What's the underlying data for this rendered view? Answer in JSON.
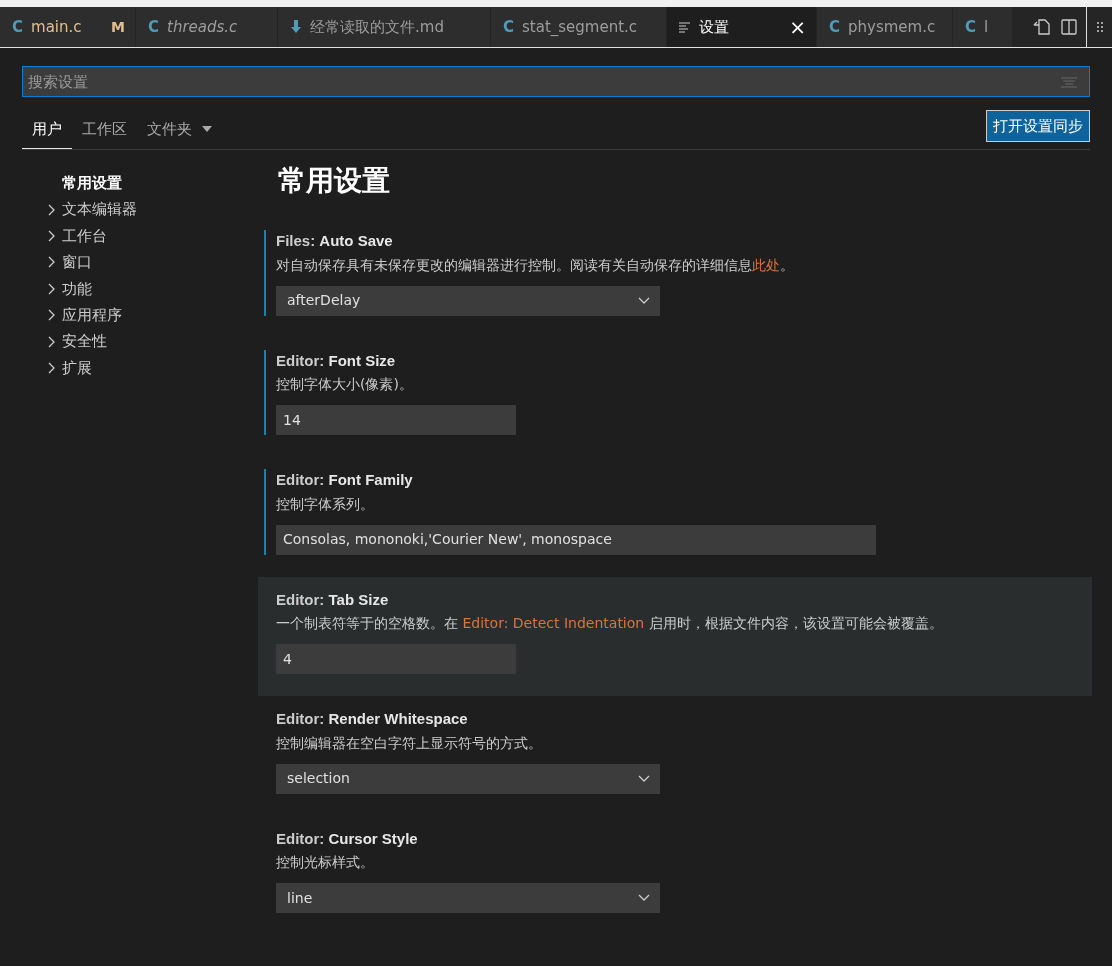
{
  "editor_tabs": [
    {
      "kind": "c",
      "icon_text": "C",
      "label": "main.c",
      "badge": "M",
      "modified": true,
      "preview": false,
      "selected": false
    },
    {
      "kind": "c",
      "icon_text": "C",
      "label": "threads.c",
      "preview": true,
      "modified": false,
      "selected": false
    },
    {
      "kind": "markdown",
      "label": "经常读取的文件.md",
      "preview": false,
      "modified": false,
      "selected": false
    },
    {
      "kind": "c",
      "icon_text": "C",
      "label": "stat_segment.c",
      "preview": false,
      "modified": false,
      "selected": false
    },
    {
      "kind": "settings",
      "label": "设置",
      "close": "×",
      "preview": false,
      "modified": false,
      "selected": true
    },
    {
      "kind": "c",
      "icon_text": "C",
      "label": "physmem.c",
      "preview": false,
      "modified": false,
      "selected": false
    },
    {
      "kind": "c",
      "icon_text": "C",
      "label": "l",
      "preview": false,
      "modified": false,
      "selected": false
    }
  ],
  "search": {
    "placeholder": "搜索设置"
  },
  "scope_tabs": [
    {
      "label": "用户",
      "selected": true
    },
    {
      "label": "工作区",
      "selected": false
    },
    {
      "label": "文件夹",
      "dropdown": true,
      "selected": false
    }
  ],
  "sync_button": "打开设置同步",
  "toc": [
    {
      "label": "常用设置",
      "expandable": false,
      "selected": true
    },
    {
      "label": "文本编辑器",
      "expandable": true,
      "selected": false
    },
    {
      "label": "工作台",
      "expandable": true,
      "selected": false
    },
    {
      "label": "窗口",
      "expandable": true,
      "selected": false
    },
    {
      "label": "功能",
      "expandable": true,
      "selected": false
    },
    {
      "label": "应用程序",
      "expandable": true,
      "selected": false
    },
    {
      "label": "安全性",
      "expandable": true,
      "selected": false
    },
    {
      "label": "扩展",
      "expandable": true,
      "selected": false
    }
  ],
  "heading": "常用设置",
  "settings": [
    {
      "category": "Files: ",
      "name": "Auto Save",
      "modified": true,
      "focused": false,
      "description": [
        {
          "text": "对自动保存具有未保存更改的编辑器进行控制。阅读有关自动保存的详细信息"
        },
        {
          "text": "此处",
          "kind": "link"
        },
        {
          "text": "。"
        }
      ],
      "kind": "dropdown",
      "value": "afterDelay"
    },
    {
      "category": "Editor: ",
      "name": "Font Size",
      "modified": true,
      "focused": false,
      "description": [
        {
          "text": "控制字体大小(像素)。"
        }
      ],
      "kind": "number",
      "value": "14"
    },
    {
      "category": "Editor: ",
      "name": "Font Family",
      "modified": true,
      "focused": false,
      "description": [
        {
          "text": "控制字体系列。"
        }
      ],
      "kind": "text",
      "value": "Consolas, mononoki,'Courier New', monospace"
    },
    {
      "category": "Editor: ",
      "name": "Tab Size",
      "modified": false,
      "focused": true,
      "description": [
        {
          "text": "一个制表符等于的空格数。在 "
        },
        {
          "text": "Editor: Detect Indentation",
          "kind": "link"
        },
        {
          "text": " 启用时，根据文件内容，该设置可能会被覆盖。"
        }
      ],
      "kind": "number",
      "value": "4"
    },
    {
      "category": "Editor: ",
      "name": "Render Whitespace",
      "modified": false,
      "focused": false,
      "description": [
        {
          "text": "控制编辑器在空白字符上显示符号的方式。"
        }
      ],
      "kind": "dropdown",
      "value": "selection"
    },
    {
      "category": "Editor: ",
      "name": "Cursor Style",
      "modified": false,
      "focused": false,
      "description": [
        {
          "text": "控制光标样式。"
        }
      ],
      "kind": "dropdown",
      "value": "line"
    }
  ]
}
